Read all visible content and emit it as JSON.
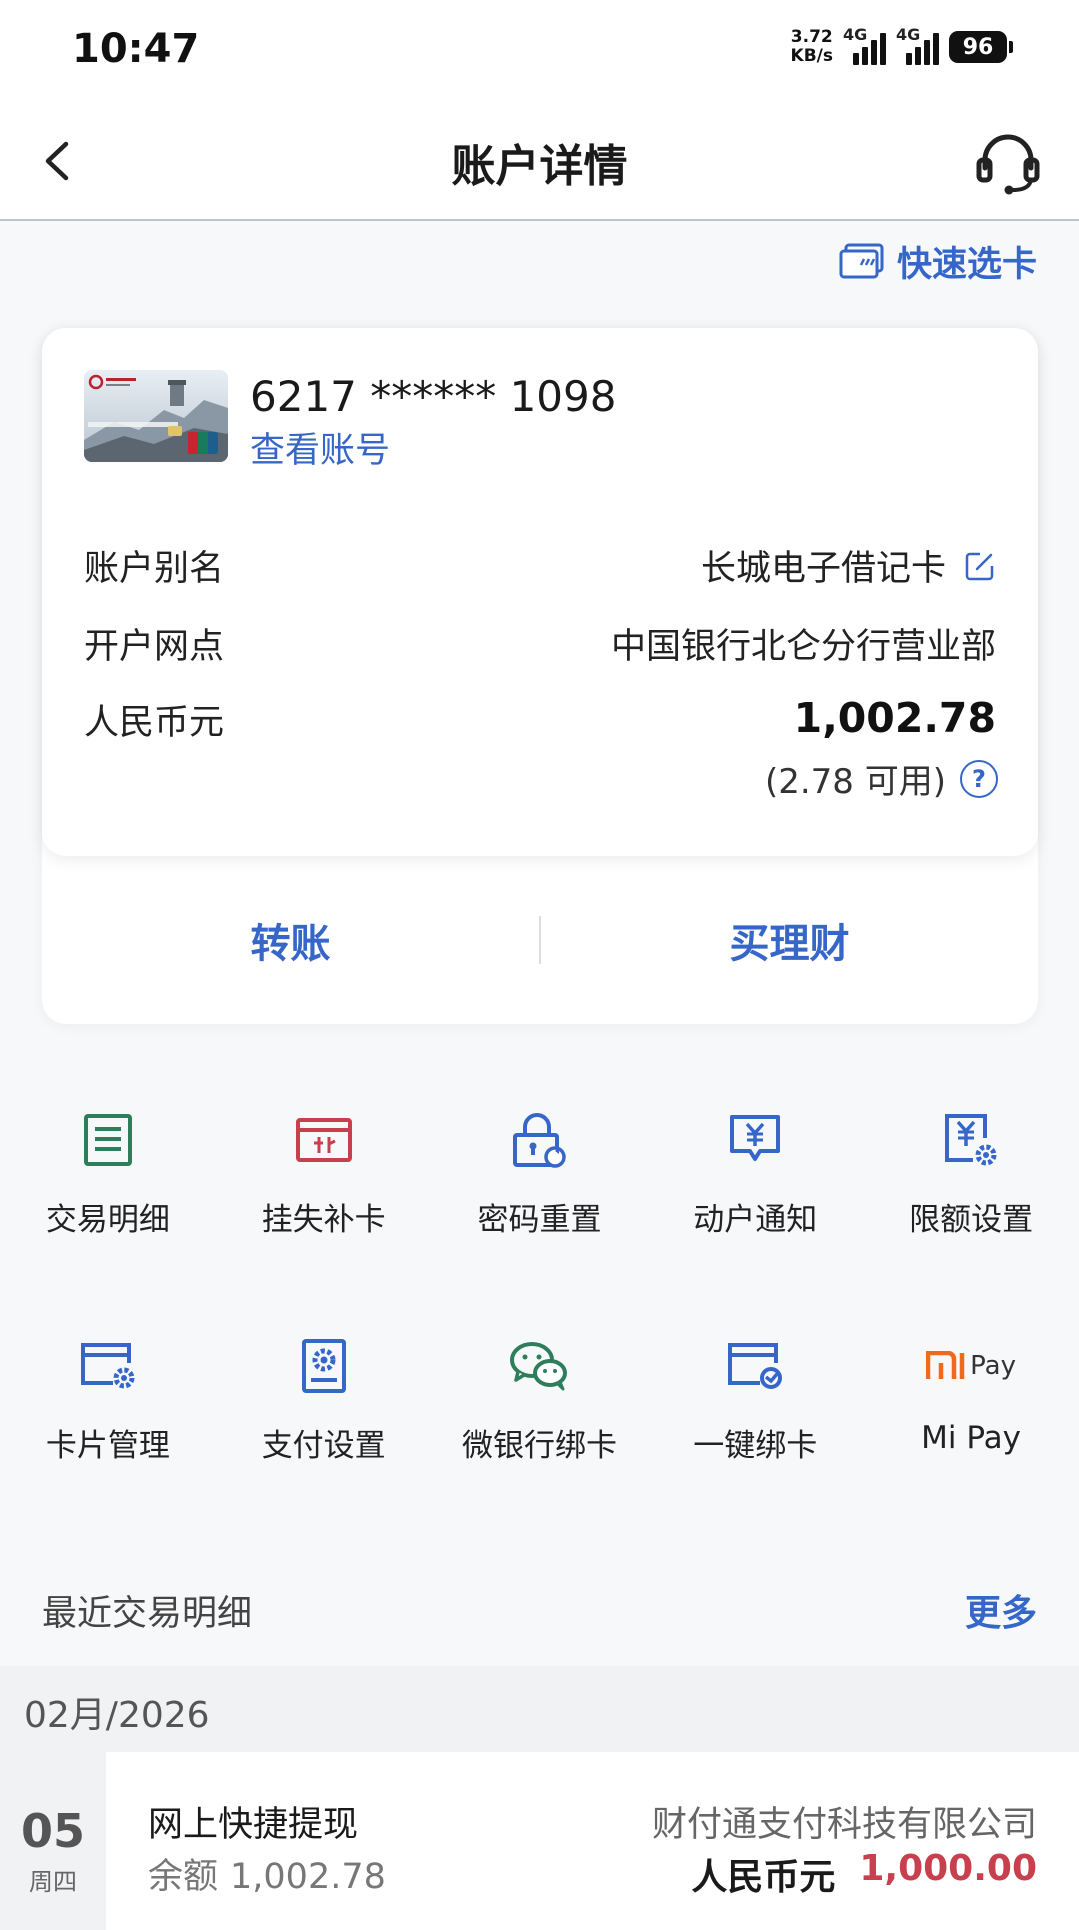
{
  "status_bar": {
    "time": "10:47",
    "net_speed_value": "3.72",
    "net_speed_unit": "KB/s",
    "signal1_label": "4G",
    "signal2_label": "4G",
    "battery": "96"
  },
  "nav": {
    "title": "账户详情",
    "back_icon": "chevron-left-icon",
    "service_icon": "headset-icon"
  },
  "quick_select": {
    "label": "快速选卡",
    "icon": "card-select-icon"
  },
  "account": {
    "card_number": "6217 ****** 1098",
    "view_account": "查看账号",
    "alias_label": "账户别名",
    "alias_value": "长城电子借记卡",
    "branch_label": "开户网点",
    "branch_value": "中国银行北仑分行营业部",
    "currency_label": "人民币元",
    "balance": "1,002.78",
    "available": "(2.78 可用)",
    "help_symbol": "?"
  },
  "card_actions": {
    "transfer": "转账",
    "buy_wealth": "买理财"
  },
  "grid": {
    "row1": [
      {
        "label": "交易明细",
        "icon": "transaction-list-icon",
        "color": "#2e7d5b"
      },
      {
        "label": "挂失补卡",
        "icon": "report-loss-icon",
        "color": "#c8404e"
      },
      {
        "label": "密码重置",
        "icon": "lock-reset-icon",
        "color": "#3566c8"
      },
      {
        "label": "动户通知",
        "icon": "yuan-notify-icon",
        "color": "#3566c8"
      },
      {
        "label": "限额设置",
        "icon": "limit-settings-icon",
        "color": "#3566c8"
      }
    ],
    "row2": [
      {
        "label": "卡片管理",
        "icon": "card-manage-icon",
        "color": "#3566c8"
      },
      {
        "label": "支付设置",
        "icon": "payment-settings-icon",
        "color": "#3566c8"
      },
      {
        "label": "微银行绑卡",
        "icon": "wechat-icon",
        "color": "#2e7d5b"
      },
      {
        "label": "一键绑卡",
        "icon": "card-bind-icon",
        "color": "#3566c8"
      },
      {
        "label": "Mi Pay",
        "icon": "mi-pay-icon",
        "color": "#f06a1d",
        "mi_text": "Pay"
      }
    ]
  },
  "recent": {
    "title": "最近交易明细",
    "more": "更多",
    "month": "02月/2026",
    "transactions": [
      {
        "day": "05",
        "weekday": "周四",
        "name": "网上快捷提现",
        "balance_label": "余额",
        "balance_value": "1,002.78",
        "merchant": "财付通支付科技有限公司",
        "currency": "人民币元",
        "amount": "1,000.00"
      }
    ]
  }
}
